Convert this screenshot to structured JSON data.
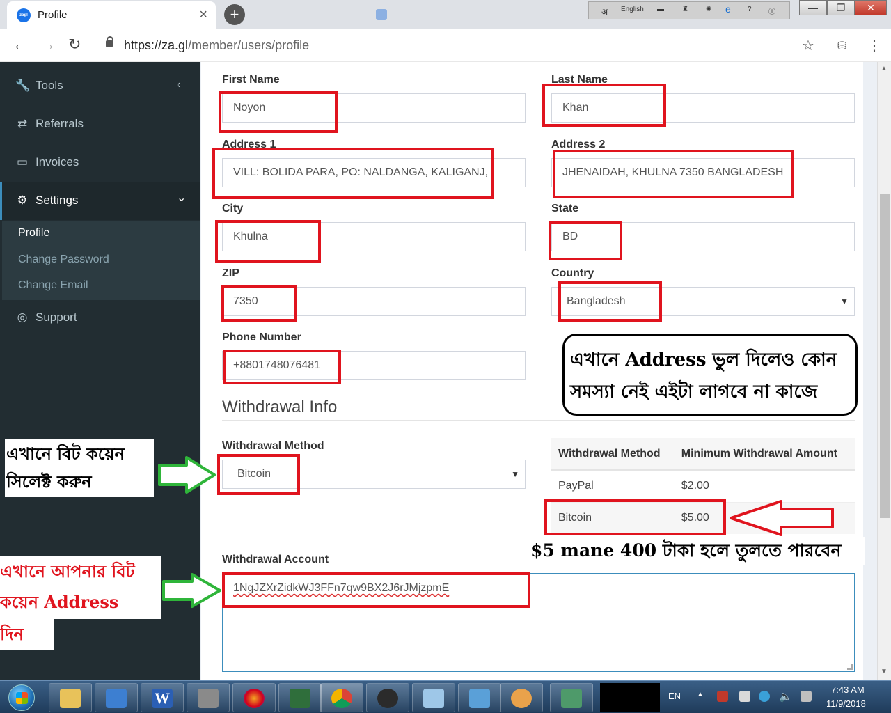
{
  "browser": {
    "tab_title": "Profile",
    "tab_close": "×",
    "new_tab": "+",
    "favicon_text": "zagl",
    "url_host": "https://za.gl",
    "url_path": "/member/users/profile",
    "back": "←",
    "forward": "→",
    "reload": "↻",
    "star": "☆",
    "menu": "⋮",
    "lang_label": "English",
    "win_min": "—",
    "win_max": "❐",
    "win_close": "✕"
  },
  "sidebar": {
    "items": [
      {
        "label": "Tools",
        "icon": "wrench-icon",
        "glyph": "🔧",
        "chevron": "‹"
      },
      {
        "label": "Referrals",
        "icon": "exchange-icon",
        "glyph": "⇄"
      },
      {
        "label": "Invoices",
        "icon": "credit-card-icon",
        "glyph": "▭"
      },
      {
        "label": "Settings",
        "icon": "gears-icon",
        "glyph": "⚙",
        "chevron": "⌄"
      },
      {
        "label": "Support",
        "icon": "life-ring-icon",
        "glyph": "◎"
      }
    ],
    "sub_items": [
      "Profile",
      "Change Password",
      "Change Email"
    ]
  },
  "form": {
    "first_name": {
      "label": "First Name",
      "value": "Noyon"
    },
    "last_name": {
      "label": "Last Name",
      "value": "Khan"
    },
    "address1": {
      "label": "Address 1",
      "value": "VILL: BOLIDA PARA, PO: NALDANGA, KALIGANJ,"
    },
    "address2": {
      "label": "Address 2",
      "value": "JHENAIDAH, KHULNA 7350 BANGLADESH"
    },
    "city": {
      "label": "City",
      "value": "Khulna"
    },
    "state": {
      "label": "State",
      "value": "BD"
    },
    "zip": {
      "label": "ZIP",
      "value": "7350"
    },
    "country": {
      "label": "Country",
      "value": "Bangladesh"
    },
    "phone": {
      "label": "Phone Number",
      "value": "+8801748076481"
    },
    "section_title": "Withdrawal Info",
    "withdrawal_method": {
      "label": "Withdrawal Method",
      "value": "Bitcoin"
    },
    "withdrawal_account": {
      "label": "Withdrawal Account",
      "value": "1NgJZXrZidkWJ3FFn7qw9BX2J6rJMjzpmE"
    },
    "select_arrow": "▼"
  },
  "withdrawal_table": {
    "headers": [
      "Withdrawal Method",
      "Minimum Withdrawal Amount"
    ],
    "rows": [
      [
        "PayPal",
        "$2.00"
      ],
      [
        "Bitcoin",
        "$5.00"
      ]
    ]
  },
  "annotations": {
    "callout_line1": "এখানে Address ভুল দিলেও কোন",
    "callout_line2": "সমস্যা নেই এইটা লাগবে না কাজে",
    "method_note_line1": "এখানে বিট কয়েন",
    "method_note_line2": "সিলেক্ট করুন",
    "amount_note": "$5 mane 400 টাকা হলে তুলতে পারবেন",
    "account_note_line1": "এখানে আপনার বিট",
    "account_note_line2": "কয়েন Address",
    "account_note_line3": "দিন"
  },
  "taskbar": {
    "language": "EN",
    "time": "7:43 AM",
    "date": "11/9/2018"
  },
  "colors": {
    "sidebar_bg": "#222d32",
    "accent": "#3c8dbc",
    "annotation_red": "#e0141e",
    "arrow_green": "#2fb53a"
  }
}
